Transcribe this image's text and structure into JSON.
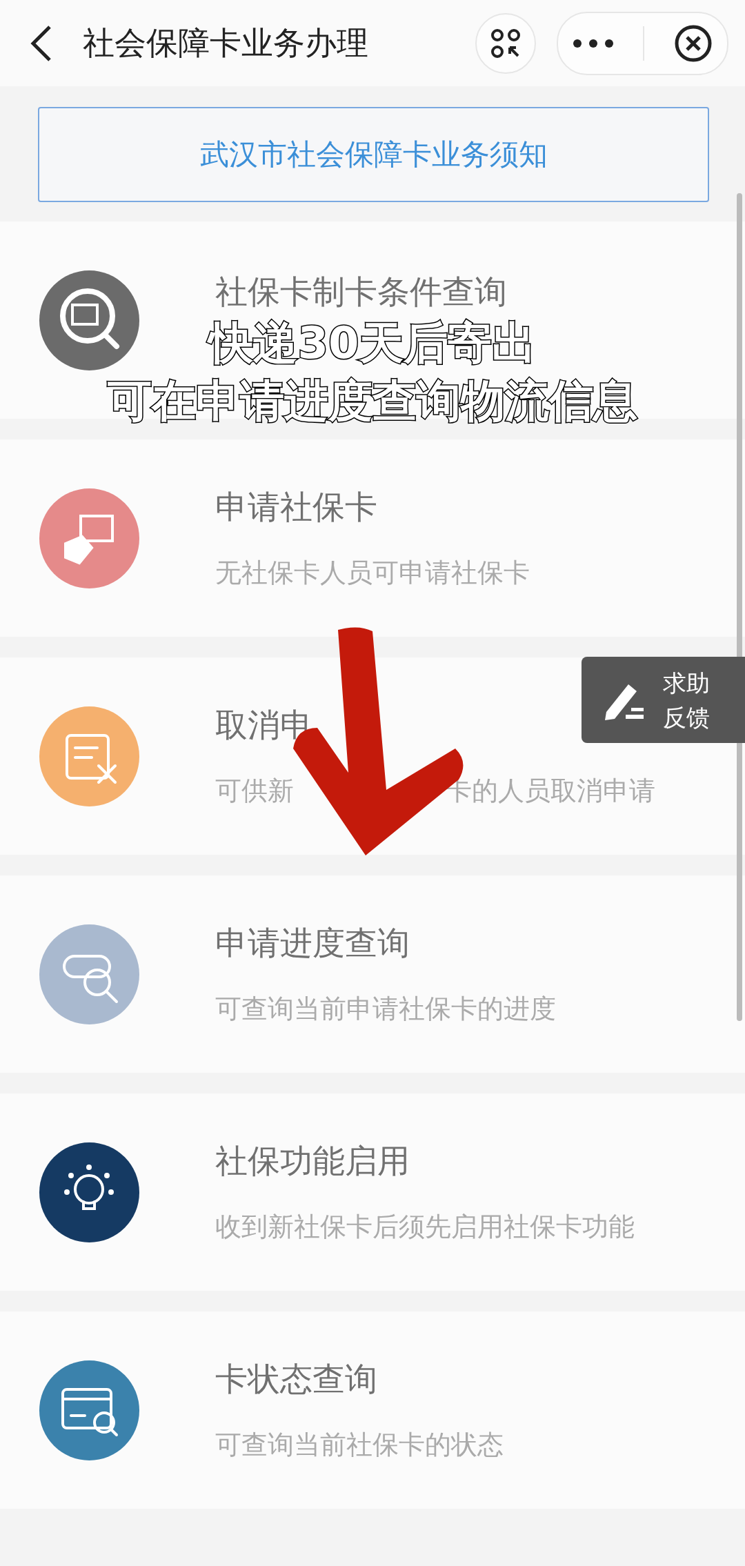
{
  "header": {
    "title": "社会保障卡业务办理"
  },
  "notice": {
    "label": "武汉市社会保障卡业务须知"
  },
  "services": [
    {
      "title": "社保卡制卡条件查询",
      "color": "#6b6b6b"
    },
    {
      "title": "申请社保卡",
      "subtitle": "无社保卡人员可申请社保卡",
      "color": "#e58a8a"
    },
    {
      "title": "取消申",
      "subtitle_parts": [
        "可供新",
        "卡的人员取消申请"
      ],
      "color": "#f5b06e"
    },
    {
      "title": "申请进度查询",
      "subtitle": "可查询当前申请社保卡的进度",
      "color": "#a9b9cf"
    },
    {
      "title": "社保功能启用",
      "subtitle": "收到新社保卡后须先启用社保卡功能",
      "color": "#153a63"
    },
    {
      "title": "卡状态查询",
      "subtitle": "可查询当前社保卡的状态",
      "color": "#3b82ac"
    }
  ],
  "feedback": {
    "lines": [
      "求助",
      "反馈"
    ]
  },
  "caption": {
    "lines": [
      "快递30天后寄出",
      "可在申请进度查询物流信息"
    ]
  }
}
